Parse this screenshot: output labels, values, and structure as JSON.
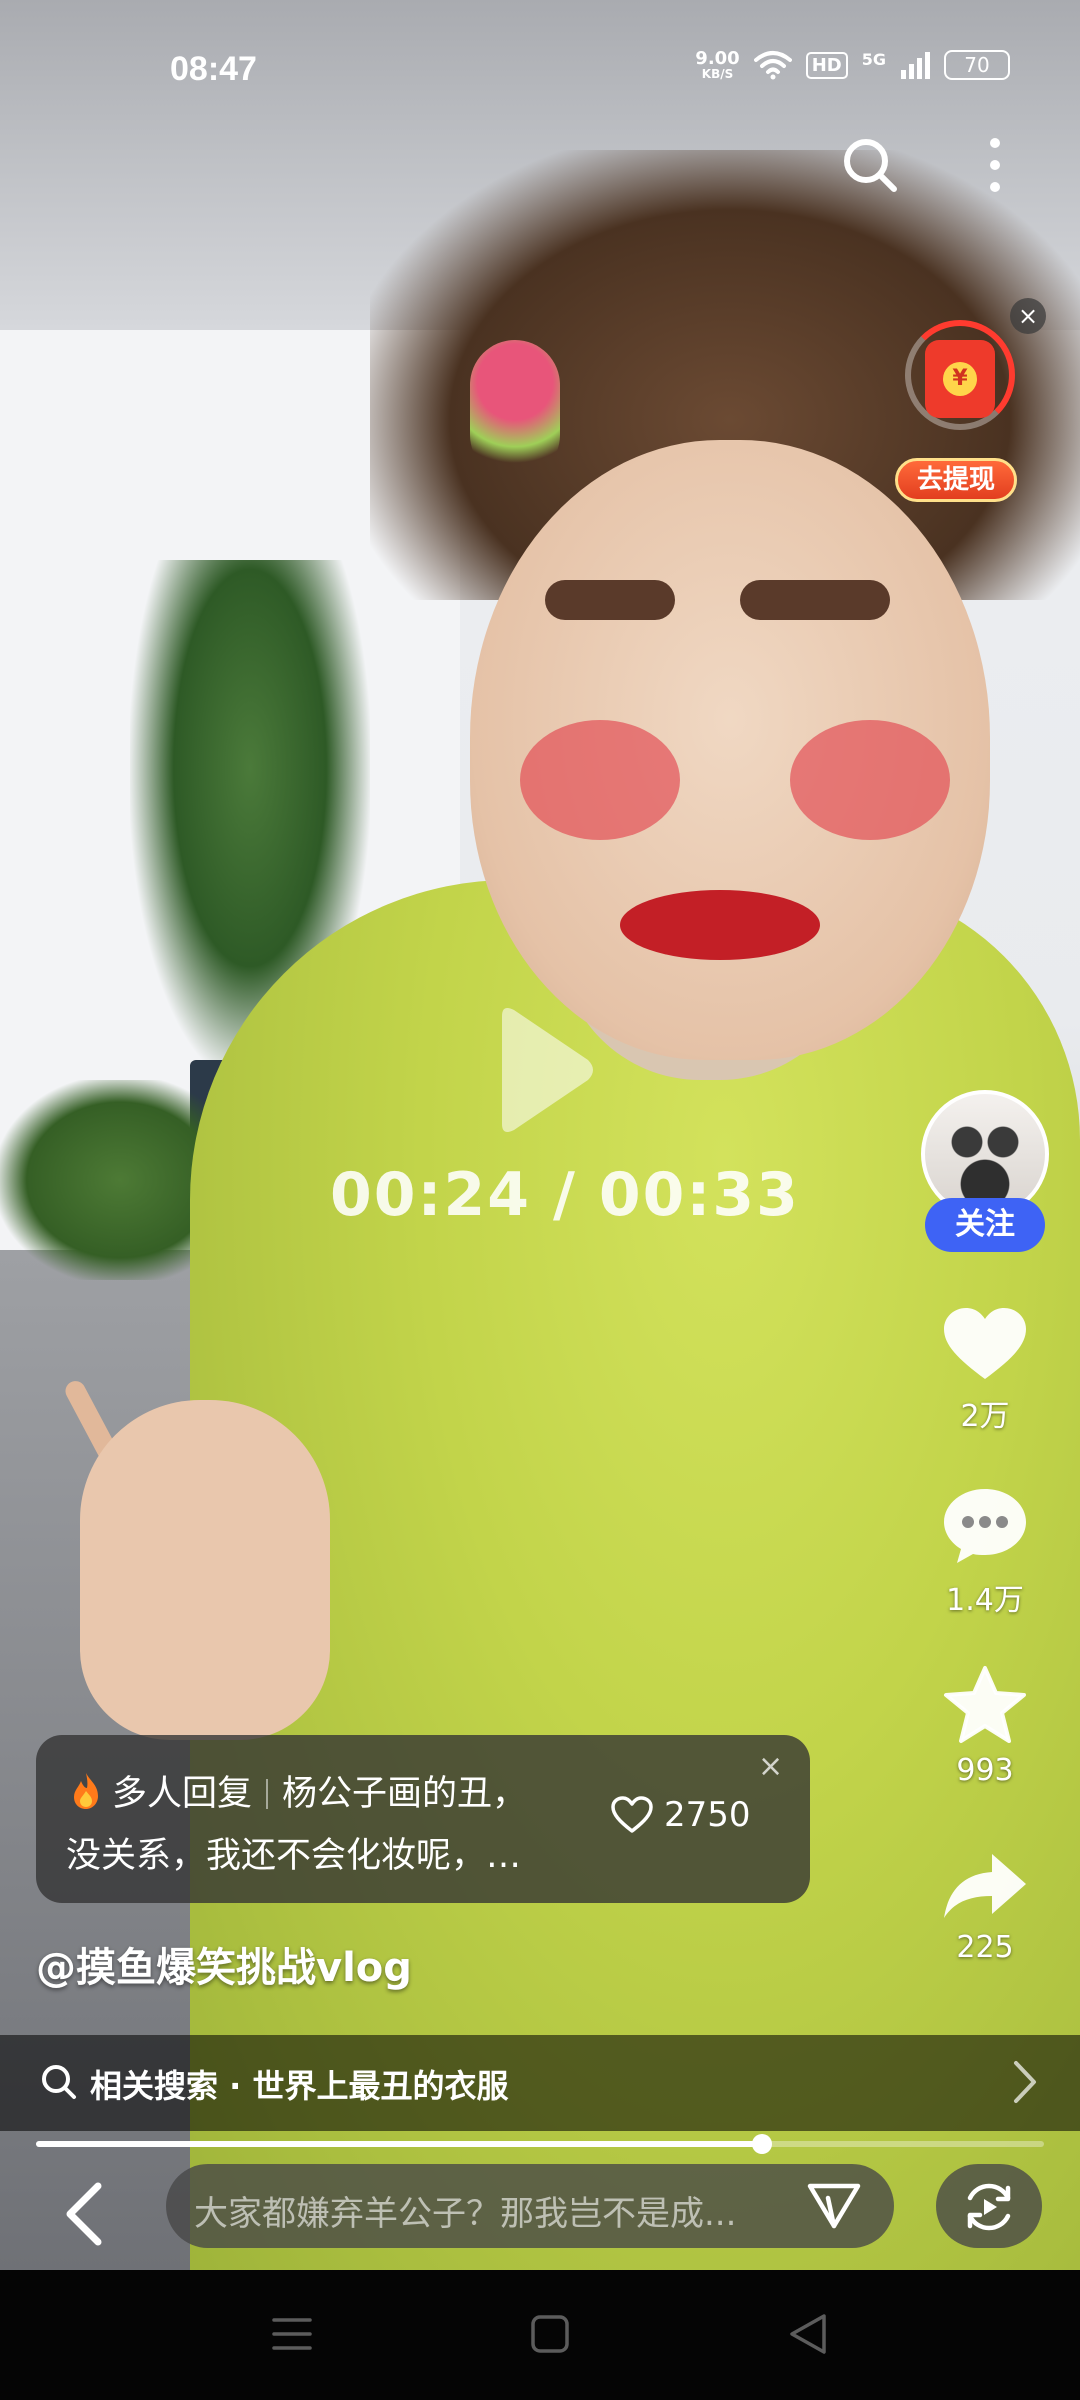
{
  "status_bar": {
    "time": "08:47",
    "net_speed_value": "9.00",
    "net_speed_unit": "KB/S",
    "hd": "HD",
    "signal": "5G",
    "battery": "70"
  },
  "reward": {
    "coin_symbol": "¥",
    "label": "去提现",
    "close_symbol": "×"
  },
  "player": {
    "current_time": "00:24",
    "separator": "/",
    "total_time": "00:33",
    "progress": 0.72
  },
  "rail": {
    "follow_label": "关注",
    "like_count": "2万",
    "comment_count": "1.4万",
    "favorite_count": "993",
    "share_count": "225"
  },
  "comment_card": {
    "tag": "多人回复",
    "line1_text": "杨公子画的丑，",
    "line2_text": "没关系，我还不会化妆呢，…",
    "like_count": "2750",
    "close_symbol": "×"
  },
  "author": {
    "handle": "@摸鱼爆笑挑战vlog"
  },
  "related_search": {
    "label": "相关搜索 · 世界上最丑的衣服"
  },
  "comment_input": {
    "placeholder": "大家都嫌弃羊公子？那我岂不是成..."
  },
  "icons": {
    "search": "search-icon",
    "more": "more-vertical-icon",
    "like": "heart-icon",
    "comment": "comment-bubble-icon",
    "favorite": "star-icon",
    "share": "share-arrow-icon",
    "fire": "fire-icon",
    "back": "chevron-left-icon",
    "send": "send-icon",
    "rotate": "screen-rotate-icon"
  },
  "colors": {
    "follow_button": "#3e63f5",
    "reward_red": "#ee3a2b",
    "reward_label_border": "#ffe08a"
  }
}
